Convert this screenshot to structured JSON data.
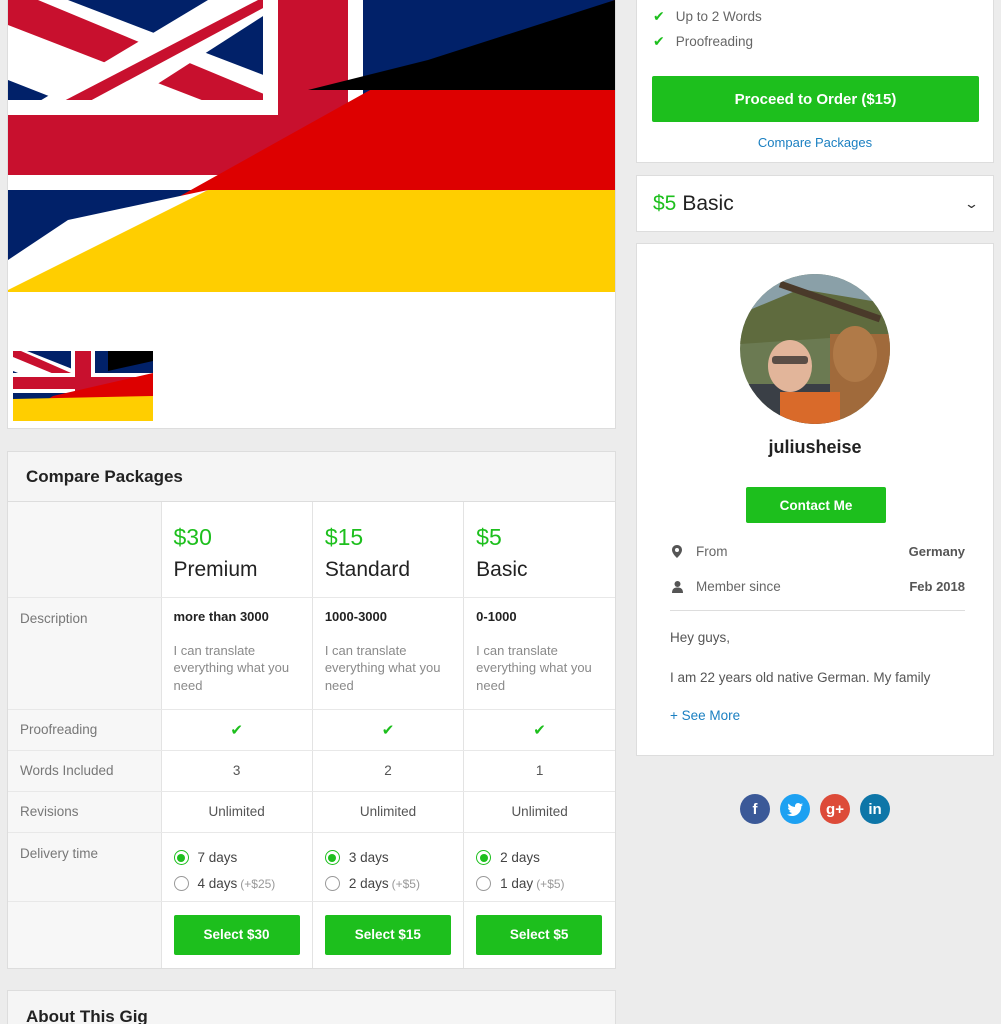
{
  "order_box": {
    "features": [
      "Up to 2 Words",
      "Proofreading"
    ],
    "order_button": "Proceed to Order ($15)",
    "compare_link": "Compare Packages"
  },
  "basic_package": {
    "price": "$5",
    "name": "Basic"
  },
  "seller": {
    "username": "juliusheise",
    "contact_button": "Contact Me",
    "from_label": "From",
    "from_value": "Germany",
    "member_label": "Member since",
    "member_value": "Feb 2018",
    "bio_line1": "Hey guys,",
    "bio_line2": "I am 22 years old native German. My family",
    "see_more": "+ See More"
  },
  "compare": {
    "title": "Compare Packages",
    "row_labels": {
      "description": "Description",
      "proofreading": "Proofreading",
      "words": "Words Included",
      "revisions": "Revisions",
      "delivery": "Delivery time"
    },
    "packages": [
      {
        "price": "$30",
        "name": "Premium",
        "desc_title": "more than 3000",
        "desc_text": "I can translate everything what you need",
        "words": "3",
        "revisions": "Unlimited",
        "delivery_primary": "7 days",
        "delivery_alt": "4 days",
        "delivery_alt_extra": "(+$25)",
        "select_button": "Select $30"
      },
      {
        "price": "$15",
        "name": "Standard",
        "desc_title": "1000-3000",
        "desc_text": "I can translate everything what you need",
        "words": "2",
        "revisions": "Unlimited",
        "delivery_primary": "3 days",
        "delivery_alt": "2 days",
        "delivery_alt_extra": "(+$5)",
        "select_button": "Select $15"
      },
      {
        "price": "$5",
        "name": "Basic",
        "desc_title": "0-1000",
        "desc_text": "I can translate everything what you need",
        "words": "1",
        "revisions": "Unlimited",
        "delivery_primary": "2 days",
        "delivery_alt": "1 day",
        "delivery_alt_extra": "(+$5)",
        "select_button": "Select $5"
      }
    ]
  },
  "about": {
    "title": "About This Gig"
  },
  "social": [
    {
      "icon": "facebook-icon",
      "glyph": "f",
      "color": "#3b5998"
    },
    {
      "icon": "twitter-icon",
      "glyph": "t",
      "color": "#1da1f2"
    },
    {
      "icon": "google-plus-icon",
      "glyph": "g+",
      "color": "#dd4b39"
    },
    {
      "icon": "linkedin-icon",
      "glyph": "in",
      "color": "#0e76a8"
    }
  ],
  "colors": {
    "accent": "#1dbf1d",
    "link": "#1a7fc1"
  }
}
